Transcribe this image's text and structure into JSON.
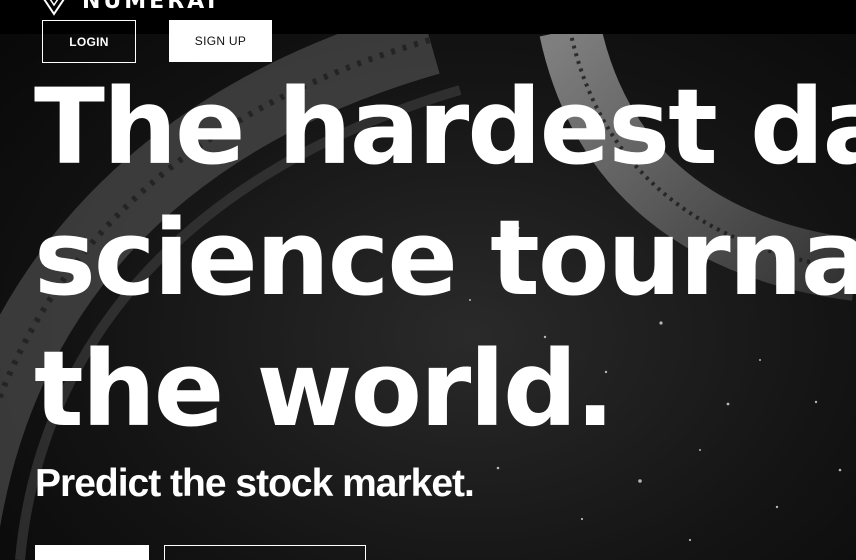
{
  "brand": {
    "logo_text": "NUMERAI",
    "logo_icon": "numerai-logo-icon"
  },
  "nav": {
    "login_label": "LOGIN",
    "signup_label": "SIGN UP"
  },
  "hero": {
    "headline_lines": [
      "The hardest data",
      "science tournament",
      "the world."
    ],
    "subheadline": "Predict the stock market."
  },
  "colors": {
    "background": "#0b0b0b",
    "text": "#ffffff",
    "topbar": "#000000"
  }
}
